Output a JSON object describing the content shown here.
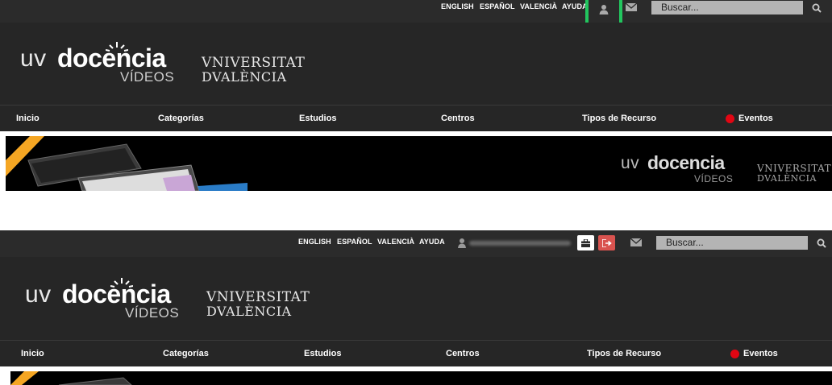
{
  "top": {
    "langs": [
      "ENGLISH",
      "ESPAÑOL",
      "VALENCIÀ",
      "AYUDA"
    ],
    "search_placeholder": "Buscar...",
    "user_icon": "user-icon",
    "mail_icon": "mail-icon",
    "search_icon": "search-icon",
    "highlight_color": "#22c55e"
  },
  "logo": {
    "uv": "uv",
    "docencia": "docencia",
    "videos": "VÍDEOS",
    "university_line1": "VNIVERSITAT",
    "university_line2": "DVALÈNCIA"
  },
  "nav": {
    "items": [
      "Inicio",
      "Categorías",
      "Estudios",
      "Centros",
      "Tipos de Recurso",
      "Eventos"
    ],
    "event_dot_color": "#e20613"
  },
  "banner": {
    "uv": "uv",
    "docencia": "docencia",
    "videos": "VÍDEOS",
    "university_line1": "VNIVERSITAT",
    "university_line2": "DVALÈNCIA"
  },
  "bottom": {
    "langs": [
      "ENGLISH",
      "ESPAÑOL",
      "VALENCIÀ",
      "AYUDA"
    ],
    "search_placeholder": "Buscar...",
    "briefcase_icon": "briefcase-icon",
    "logout_icon": "logout-icon",
    "logout_color": "#d9534f"
  }
}
